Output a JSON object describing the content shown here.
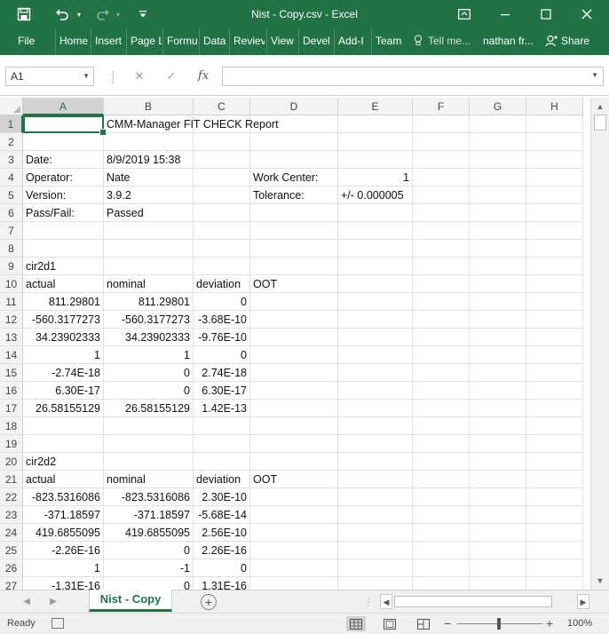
{
  "window": {
    "title": "Nist - Copy.csv - Excel",
    "quick_access": {
      "save": "save-icon",
      "undo": "undo-icon",
      "redo": "redo-icon",
      "customize": "customize-icon"
    },
    "controls": {
      "restore": "ribbon-display-icon",
      "minimize": "minimize-icon",
      "maximize": "maximize-icon",
      "close": "close-icon"
    }
  },
  "ribbon": {
    "tabs": [
      "File",
      "Home",
      "Insert",
      "Page L",
      "Formu",
      "Data",
      "Reviev",
      "View",
      "Devel",
      "Add-I",
      "Team"
    ],
    "tell_me": "Tell me...",
    "user": "nathan fr...",
    "share": "Share"
  },
  "formula_bar": {
    "name_box": "A1",
    "cancel": "✕",
    "enter": "✓",
    "fx": "fx",
    "value": ""
  },
  "grid": {
    "columns": [
      "A",
      "B",
      "C",
      "D",
      "E",
      "F",
      "G",
      "H"
    ],
    "active_column": "A",
    "active_row": 1,
    "rows": [
      {
        "n": "1",
        "A": "",
        "B": "CMM-Manager FIT CHECK Report",
        "C": "",
        "D": "",
        "E": ""
      },
      {
        "n": "2",
        "A": "",
        "B": "",
        "C": "",
        "D": "",
        "E": ""
      },
      {
        "n": "3",
        "A": "Date:",
        "B": "8/9/2019 15:38",
        "C": "",
        "D": "",
        "E": ""
      },
      {
        "n": "4",
        "A": "Operator:",
        "B": "Nate",
        "C": "",
        "D": "Work Center:",
        "E": "1"
      },
      {
        "n": "5",
        "A": "Version:",
        "B": "3.9.2",
        "C": "",
        "D": "Tolerance:",
        "E": "+/- 0.000005"
      },
      {
        "n": "6",
        "A": "Pass/Fail:",
        "B": "Passed",
        "C": "",
        "D": "",
        "E": ""
      },
      {
        "n": "7",
        "A": "",
        "B": "",
        "C": "",
        "D": "",
        "E": ""
      },
      {
        "n": "8",
        "A": "",
        "B": "",
        "C": "",
        "D": "",
        "E": ""
      },
      {
        "n": "9",
        "A": "cir2d1",
        "B": "",
        "C": "",
        "D": "",
        "E": ""
      },
      {
        "n": "10",
        "A": "actual",
        "B": "nominal",
        "C": "deviation",
        "D": "OOT",
        "E": ""
      },
      {
        "n": "11",
        "A": "811.29801",
        "B": "811.29801",
        "C": "0",
        "D": "",
        "E": ""
      },
      {
        "n": "12",
        "A": "-560.3177273",
        "B": "-560.3177273",
        "C": "-3.68E-10",
        "D": "",
        "E": ""
      },
      {
        "n": "13",
        "A": "34.23902333",
        "B": "34.23902333",
        "C": "-9.76E-10",
        "D": "",
        "E": ""
      },
      {
        "n": "14",
        "A": "1",
        "B": "1",
        "C": "0",
        "D": "",
        "E": ""
      },
      {
        "n": "15",
        "A": "-2.74E-18",
        "B": "0",
        "C": "2.74E-18",
        "D": "",
        "E": ""
      },
      {
        "n": "16",
        "A": "6.30E-17",
        "B": "0",
        "C": "6.30E-17",
        "D": "",
        "E": ""
      },
      {
        "n": "17",
        "A": "26.58155129",
        "B": "26.58155129",
        "C": "1.42E-13",
        "D": "",
        "E": ""
      },
      {
        "n": "18",
        "A": "",
        "B": "",
        "C": "",
        "D": "",
        "E": ""
      },
      {
        "n": "19",
        "A": "",
        "B": "",
        "C": "",
        "D": "",
        "E": ""
      },
      {
        "n": "20",
        "A": "cir2d2",
        "B": "",
        "C": "",
        "D": "",
        "E": ""
      },
      {
        "n": "21",
        "A": "actual",
        "B": "nominal",
        "C": "deviation",
        "D": "OOT",
        "E": ""
      },
      {
        "n": "22",
        "A": "-823.5316086",
        "B": "-823.5316086",
        "C": "2.30E-10",
        "D": "",
        "E": ""
      },
      {
        "n": "23",
        "A": "-371.18597",
        "B": "-371.18597",
        "C": "-5.68E-14",
        "D": "",
        "E": ""
      },
      {
        "n": "24",
        "A": "419.6855095",
        "B": "419.6855095",
        "C": "2.56E-10",
        "D": "",
        "E": ""
      },
      {
        "n": "25",
        "A": "-2.26E-16",
        "B": "0",
        "C": "2.26E-16",
        "D": "",
        "E": ""
      },
      {
        "n": "26",
        "A": "1",
        "B": "-1",
        "C": "0",
        "D": "",
        "E": ""
      },
      {
        "n": "27",
        "A": "-1.31E-16",
        "B": "0",
        "C": "1.31E-16",
        "D": "",
        "E": ""
      }
    ]
  },
  "sheets": {
    "active": "Nist - Copy",
    "add": "+"
  },
  "status": {
    "ready": "Ready",
    "zoom": "100%",
    "zoom_level": 1.0,
    "views": [
      "normal-view-icon",
      "page-layout-view-icon",
      "page-break-preview-icon"
    ]
  },
  "colors": {
    "accent": "#217346",
    "grid_line": "#e1e1e1",
    "header_bg": "#f3f3f3"
  }
}
